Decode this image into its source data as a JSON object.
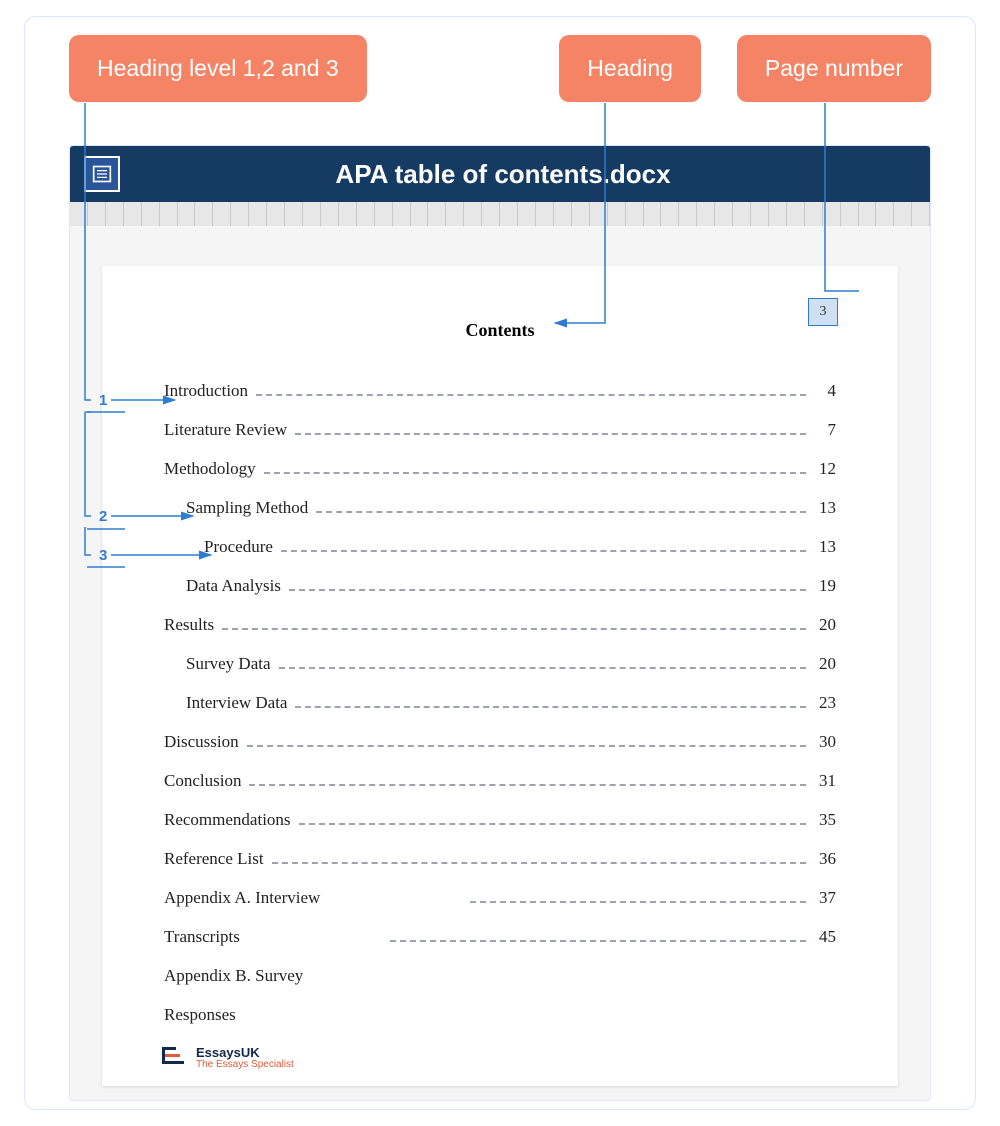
{
  "callouts": {
    "heading_levels": "Heading level 1,2 and 3",
    "heading": "Heading",
    "page_number": "Page number"
  },
  "document": {
    "title": "APA table of contents.docx",
    "page_number": "3",
    "contents_heading": "Contents"
  },
  "levels": {
    "l1": "1",
    "l2": "2",
    "l3": "3"
  },
  "toc": [
    {
      "label": "Introduction",
      "page": "4",
      "indent": 1
    },
    {
      "label": "Literature Review",
      "page": "7",
      "indent": 1
    },
    {
      "label": "Methodology",
      "page": "12",
      "indent": 1
    },
    {
      "label": "Sampling Method",
      "page": "13",
      "indent": 2
    },
    {
      "label": "Procedure",
      "page": "13",
      "indent": 3
    },
    {
      "label": "Data Analysis",
      "page": "19",
      "indent": 2
    },
    {
      "label": "Results",
      "page": "20",
      "indent": 1
    },
    {
      "label": "Survey Data",
      "page": "20",
      "indent": 2
    },
    {
      "label": "Interview Data",
      "page": "23",
      "indent": 2
    },
    {
      "label": "Discussion",
      "page": "30",
      "indent": 1
    },
    {
      "label": "Conclusion",
      "page": "31",
      "indent": 1
    },
    {
      "label": "Recommendations",
      "page": "35",
      "indent": 1
    },
    {
      "label": "Reference List",
      "page": "36",
      "indent": 1
    },
    {
      "label": "Appendix A. Interview",
      "page": "37",
      "indent": 1,
      "partial": true
    },
    {
      "label": "Transcripts",
      "page": "45",
      "indent": 1,
      "partial": true
    },
    {
      "label": "Appendix B. Survey",
      "page": "",
      "indent": 1,
      "nodots": true
    },
    {
      "label": "Responses",
      "page": "",
      "indent": 1,
      "nodots": true
    }
  ],
  "brand": {
    "name": "EssaysUK",
    "tagline": "The Essays Specialist"
  }
}
